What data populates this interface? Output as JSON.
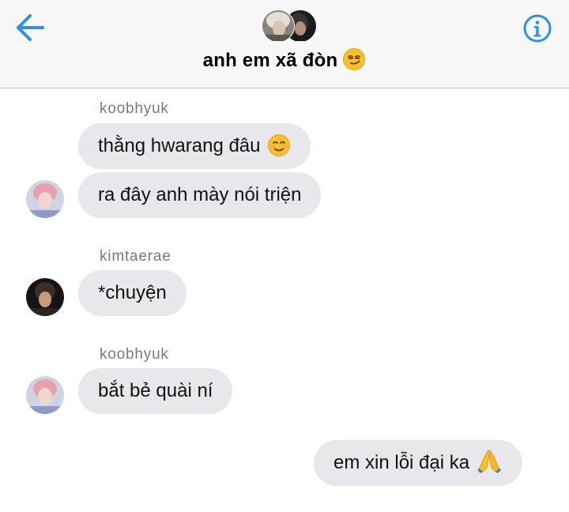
{
  "header": {
    "title": "anh em xã đòn",
    "title_emoji": "smirking-face-emoji",
    "back_icon": "back-arrow-icon",
    "info_icon": "info-icon",
    "accent_color": "#2f8fe0"
  },
  "messages": [
    {
      "sender": "koobhyuk",
      "text": "thằng hwarang đâu",
      "emoji": "smiling-face-emoji",
      "direction": "incoming"
    },
    {
      "sender": "koobhyuk",
      "text": "ra đây anh mày nói triện",
      "direction": "incoming"
    },
    {
      "sender": "kimtaerae",
      "text": "*chuyện",
      "direction": "incoming"
    },
    {
      "sender": "koobhyuk",
      "text": "bắt bẻ quài ní",
      "direction": "incoming"
    },
    {
      "sender": "me",
      "text": "em xin lỗi đại ka",
      "emoji": "folded-hands-emoji",
      "direction": "outgoing"
    }
  ],
  "senders": {
    "s1": "koobhyuk",
    "s2": "kimtaerae",
    "s3": "koobhyuk"
  },
  "colors": {
    "bubble": "#e8e8ec",
    "header_bg": "#f7f7f8",
    "sender_name": "#7a7a7e"
  }
}
